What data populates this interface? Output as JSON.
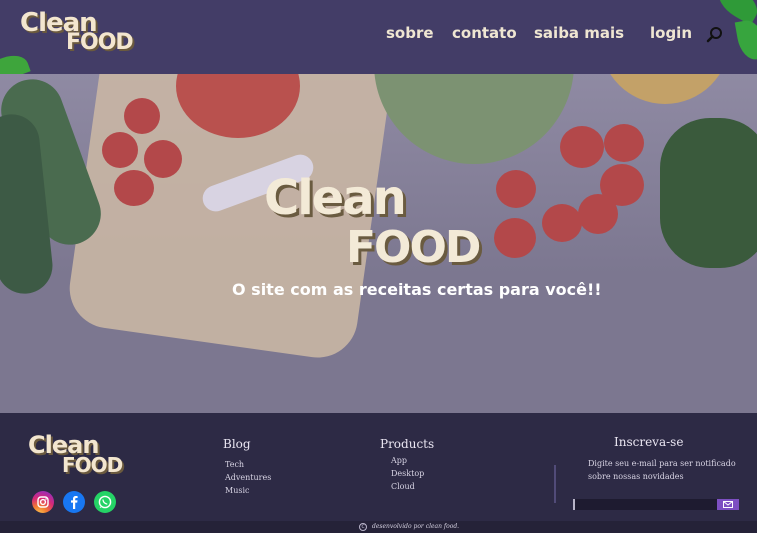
{
  "brand": {
    "line1": "Clean",
    "line2": "FOOD"
  },
  "nav": {
    "sobre": "sobre",
    "contato": "contato",
    "saiba_mais": "saiba mais",
    "login": "login"
  },
  "hero": {
    "title_line1": "Clean",
    "title_line2": "FOOD",
    "subtitle": "O site com as receitas certas para você!!"
  },
  "footer": {
    "logo": {
      "line1": "Clean",
      "line2": "FOOD"
    },
    "social": [
      "instagram-icon",
      "facebook-icon",
      "whatsapp-icon"
    ],
    "blog": {
      "heading": "Blog",
      "links": [
        "Tech",
        "Adventures",
        "Music"
      ]
    },
    "products": {
      "heading": "Products",
      "links": [
        "App",
        "Desktop",
        "Cloud"
      ]
    },
    "newsletter": {
      "heading": "Inscreva-se",
      "text": "Digite seu e-mail para ser notificado sobre nossas novidades",
      "placeholder": ""
    },
    "copyright": "desenvolvido por clean food."
  },
  "colors": {
    "header_bg": "#433d67",
    "footer_bg": "#2d2a45",
    "accent": "#7d4fc2",
    "brand_cream": "#f3e6cf"
  }
}
